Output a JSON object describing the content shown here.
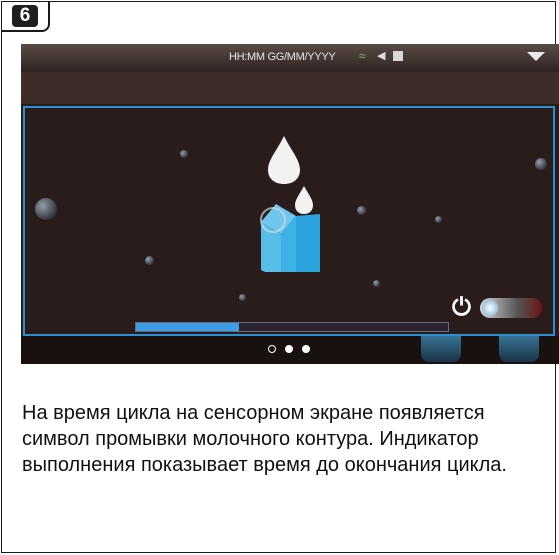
{
  "step": {
    "number": "6"
  },
  "screen": {
    "status_bar": {
      "time_format": "HH:MM GG/MM/YYYY",
      "icons": [
        "wifi-icon",
        "speaker-icon",
        "cup-icon",
        "dropdown-arrow-icon"
      ]
    },
    "main_icon": "milk-circuit-rinse-icon",
    "power_icon": "power-icon",
    "progress": {
      "fraction": 0.33,
      "color": "#3d9ee8"
    },
    "page_dots": {
      "count": 3,
      "current": 0
    },
    "accent_color": "#2e8fd0"
  },
  "caption": {
    "text": "На время цикла на сенсорном экране появляется символ промывки молочного контура.  Индикатор выполнения показывает время до окончания цикла."
  }
}
